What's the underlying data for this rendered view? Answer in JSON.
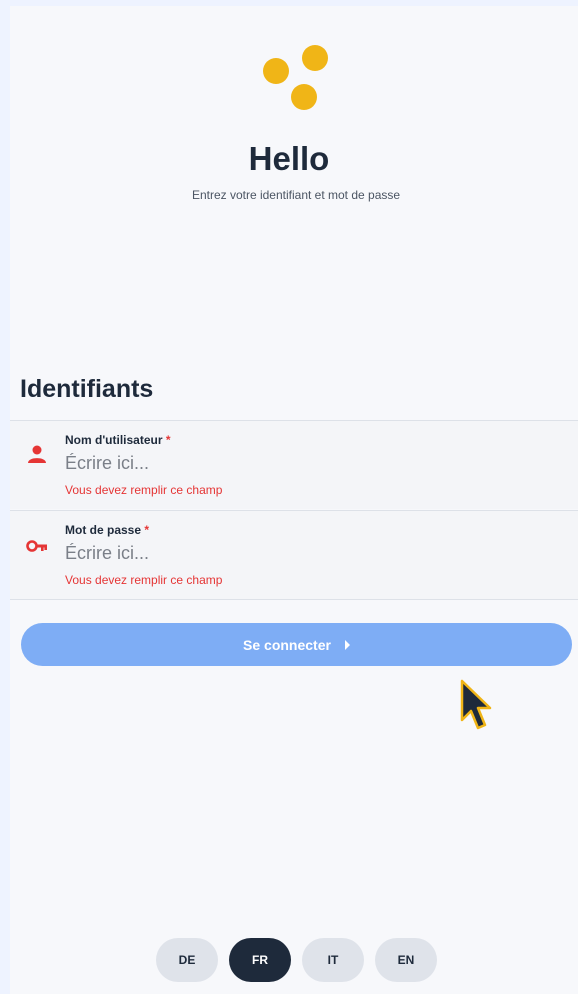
{
  "brand": {
    "logo_color": "#f0b517"
  },
  "header": {
    "title": "Hello",
    "subtitle": "Entrez votre identifiant et mot de passe"
  },
  "credentials": {
    "section_title": "Identifiants",
    "username": {
      "label": "Nom d'utilisateur",
      "required_mark": "*",
      "placeholder": "Écrire ici...",
      "error": "Vous devez remplir ce champ",
      "icon": "user-icon"
    },
    "password": {
      "label": "Mot de passe",
      "required_mark": "*",
      "placeholder": "Écrire ici...",
      "error": "Vous devez remplir ce champ",
      "icon": "key-icon"
    }
  },
  "login_button": {
    "label": "Se connecter",
    "icon": "caret-right-icon",
    "color": "#7eadf5"
  },
  "languages": {
    "items": [
      {
        "code": "DE",
        "active": false
      },
      {
        "code": "FR",
        "active": true
      },
      {
        "code": "IT",
        "active": false
      },
      {
        "code": "EN",
        "active": false
      }
    ]
  },
  "colors": {
    "error": "#e53535",
    "text": "#1e2a3b",
    "active_lang": "#1e2a3b"
  }
}
